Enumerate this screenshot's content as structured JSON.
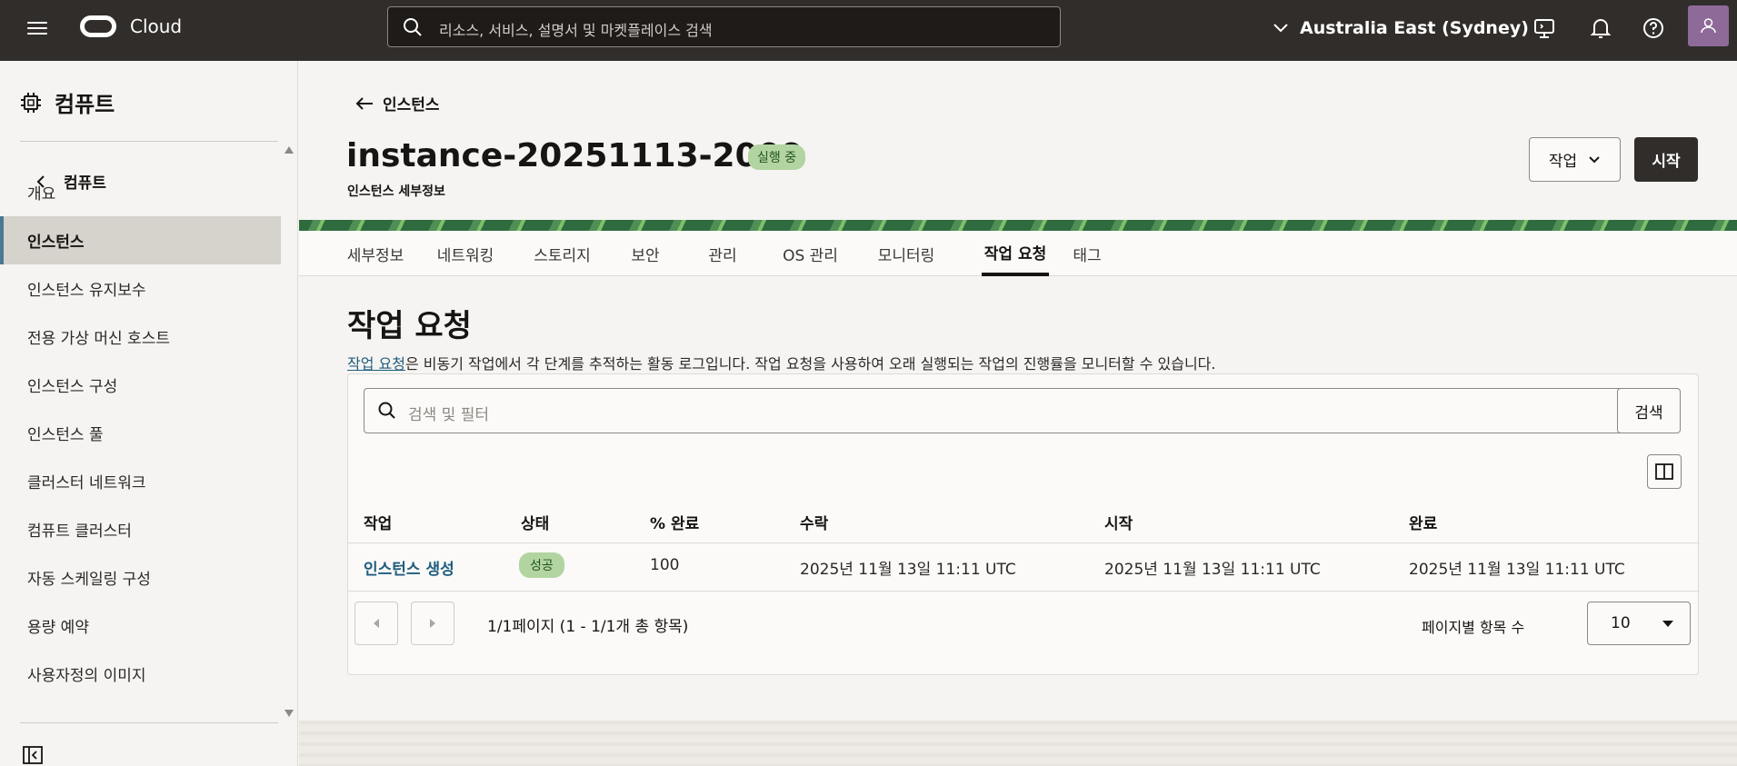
{
  "topbar": {
    "brand": "Cloud",
    "search_placeholder": "리소스, 서비스, 설명서 및 마켓플레이스 검색",
    "region": "Australia East (Sydney)"
  },
  "sidebar": {
    "heading": "컴퓨트",
    "back_label": "컴퓨트",
    "items": [
      {
        "label": "개요",
        "active": false
      },
      {
        "label": "인스턴스",
        "active": true
      },
      {
        "label": "인스턴스 유지보수",
        "active": false
      },
      {
        "label": "전용 가상 머신 호스트",
        "active": false
      },
      {
        "label": "인스턴스 구성",
        "active": false
      },
      {
        "label": "인스턴스 풀",
        "active": false
      },
      {
        "label": "클러스터 네트워크",
        "active": false
      },
      {
        "label": "컴퓨트 클러스터",
        "active": false
      },
      {
        "label": "자동 스케일링 구성",
        "active": false
      },
      {
        "label": "용량 예약",
        "active": false
      },
      {
        "label": "사용자정의 이미지",
        "active": false
      }
    ]
  },
  "header": {
    "back_label": "인스턴스",
    "title": "instance-20251113-2009",
    "status": "실행 중",
    "subtitle": "인스턴스 세부정보",
    "action_label": "작업",
    "start_label": "시작"
  },
  "tabs": [
    "세부정보",
    "네트워킹",
    "스토리지",
    "보안",
    "관리",
    "OS 관리",
    "모니터링",
    "작업 요청",
    "태그"
  ],
  "active_tab": "작업 요청",
  "section": {
    "title": "작업 요청",
    "desc_link": "작업 요청",
    "desc_rest": "은 비동기 작업에서 각 단계를 추적하는 활동 로그입니다. 작업 요청을 사용하여 오래 실행되는 작업의 진행률을 모니터할 수 있습니다."
  },
  "filter": {
    "placeholder": "검색 및 필터",
    "search_label": "검색"
  },
  "table": {
    "columns": [
      "작업",
      "상태",
      "% 완료",
      "수락",
      "시작",
      "완료"
    ],
    "rows": [
      {
        "operation": "인스턴스 생성",
        "status": "성공",
        "percent": "100",
        "accepted": "2025년 11월 13일 11:11 UTC",
        "started": "2025년 11월 13일 11:11 UTC",
        "finished": "2025년 11월 13일 11:11 UTC"
      }
    ]
  },
  "pagination": {
    "info": "1/1페이지 (1 - 1/1개 총 항목)",
    "per_page_label": "페이지별 항목 수",
    "per_page_value": "10"
  },
  "colors": {
    "topbar": "#312d2a",
    "link": "#1f5d7e",
    "success_badge": "#b2d4a1",
    "active_marker": "#4b7893"
  }
}
